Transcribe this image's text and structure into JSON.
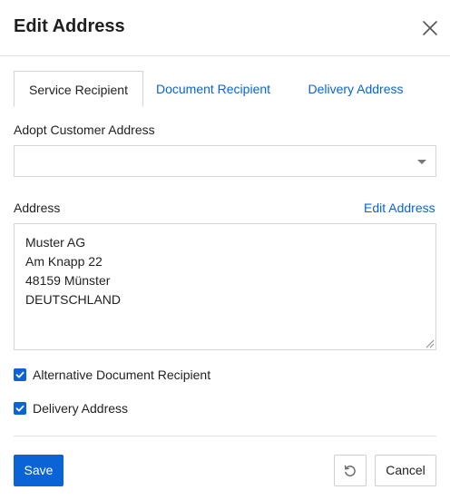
{
  "dialog": {
    "title": "Edit Address",
    "close_icon": "close-icon"
  },
  "tabs": [
    {
      "label": "Service Recipient",
      "active": true
    },
    {
      "label": "Document Recipient",
      "active": false
    },
    {
      "label": "Delivery Address",
      "active": false
    }
  ],
  "adopt": {
    "label": "Adopt Customer Address",
    "selected_value": ""
  },
  "address": {
    "label": "Address",
    "edit_link": "Edit Address",
    "lines": [
      "Muster AG",
      "Am Knapp 22",
      "48159 Münster",
      "DEUTSCHLAND"
    ]
  },
  "options": [
    {
      "label": "Alternative Document Recipient",
      "checked": true
    },
    {
      "label": "Delivery Address",
      "checked": true
    }
  ],
  "footer": {
    "save_label": "Save",
    "reset_icon": "reset-icon",
    "cancel_label": "Cancel"
  },
  "colors": {
    "accent": "#0a64d6",
    "text": "#222222",
    "border": "#d6d6d6"
  }
}
